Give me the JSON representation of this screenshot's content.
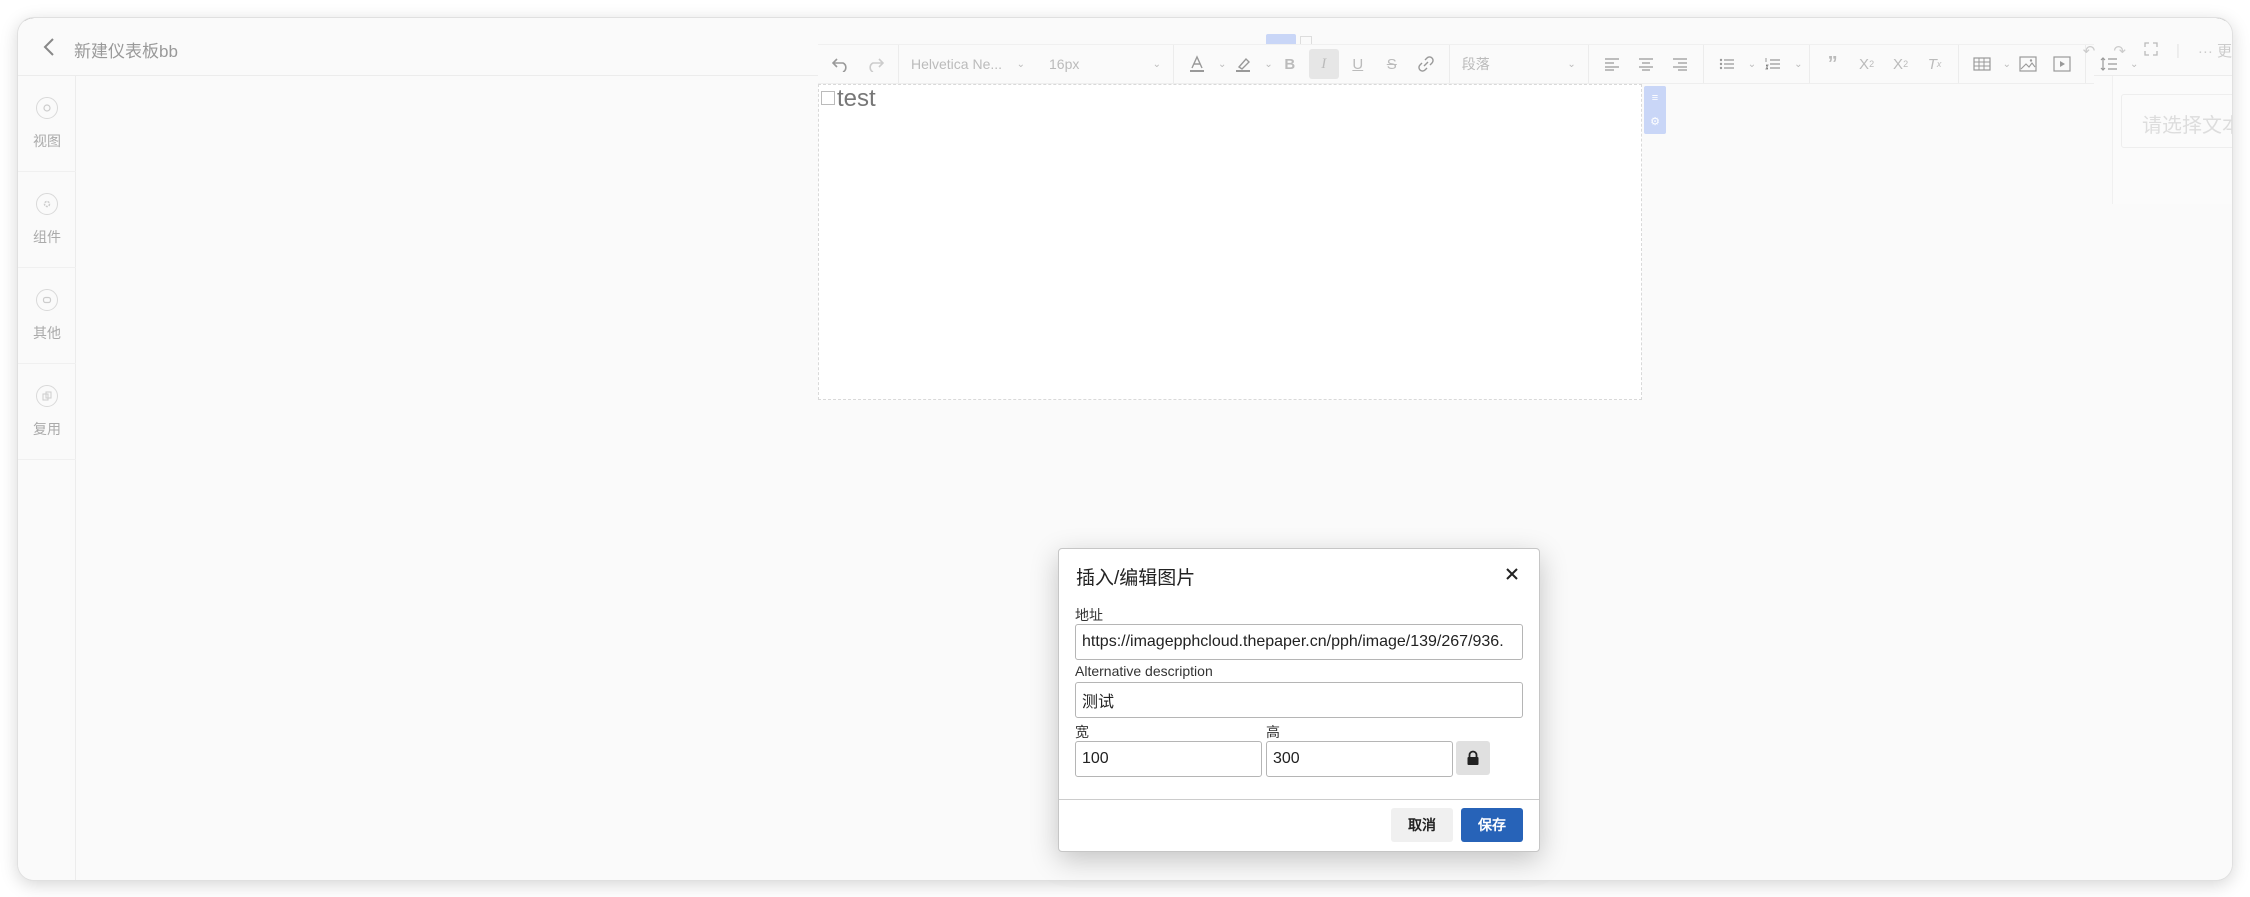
{
  "header": {
    "title": "新建仪表板bb"
  },
  "sidebar": {
    "items": [
      {
        "label": "视图"
      },
      {
        "label": "组件"
      },
      {
        "label": "其他"
      },
      {
        "label": "复用"
      }
    ]
  },
  "toolbar": {
    "font_family": "Helvetica Ne...",
    "font_size": "16px",
    "block_format": "段落"
  },
  "editor": {
    "image_alt": "test"
  },
  "right_panel": {
    "placeholder": "请选择文本"
  },
  "top_right": {
    "more_label": "··· 更"
  },
  "dialog": {
    "title": "插入/编辑图片",
    "url_label": "地址",
    "url_value": "https://imagepphcloud.thepaper.cn/pph/image/139/267/936.",
    "alt_label": "Alternative description",
    "alt_value": "测试",
    "width_label": "宽",
    "width_value": "100",
    "height_label": "高",
    "height_value": "300",
    "cancel_label": "取消",
    "save_label": "保存"
  }
}
